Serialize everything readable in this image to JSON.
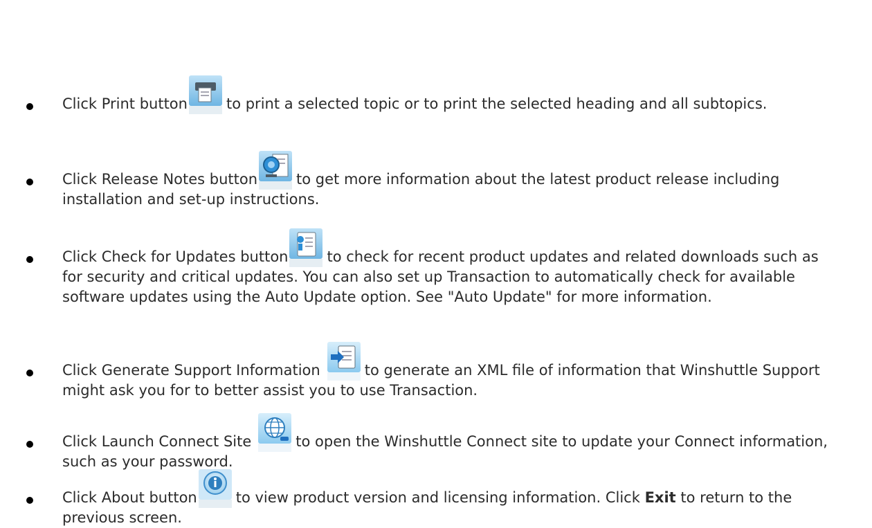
{
  "items": [
    {
      "before": "Click Print button",
      "after": "to print a selected topic or to print the selected heading and all subtopics.",
      "icon": "print-icon"
    },
    {
      "before": "Click Release Notes button",
      "after": "to get more information about the latest product release including installation and set-up instructions.",
      "icon": "release-notes-icon"
    },
    {
      "before": "Click Check for Updates button",
      "after": "to check for recent product updates and related downloads such as for security and critical updates. You can also set up Transaction to automatically check for available software updates using the Auto Update option. See \"Auto Update\" for more information.",
      "icon": "check-updates-icon"
    },
    {
      "before": "Click Generate Support Information",
      "after": "to generate an XML file of information that Winshuttle Support might ask you for to better assist you to use Transaction.",
      "icon": "support-info-icon"
    },
    {
      "before": "Click Launch Connect Site",
      "after": "to open the Winshuttle Connect site to update your Connect information, such as your password.",
      "icon": "globe-connect-icon"
    },
    {
      "before": "Click About button",
      "after_1": "to view product version and licensing information. Click",
      "bold": "Exit",
      "after_2": "to return to the previous screen.",
      "icon": "about-info-icon"
    }
  ]
}
